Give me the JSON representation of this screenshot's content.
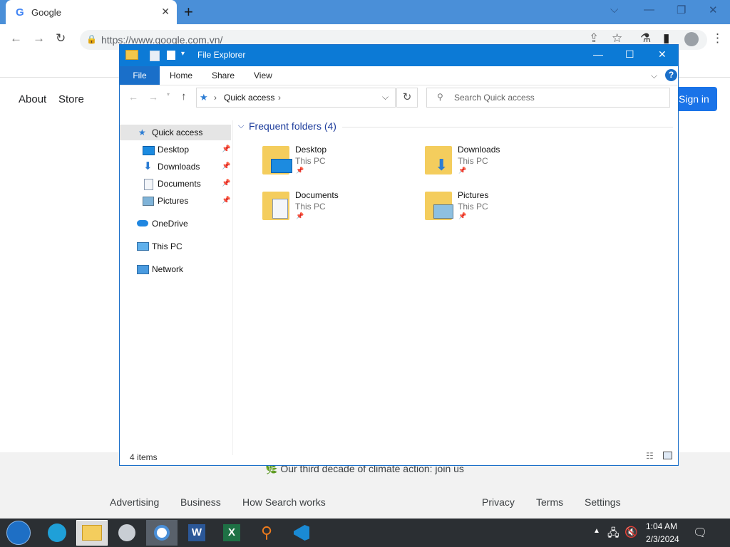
{
  "browser": {
    "tab_title": "Google",
    "tab_favicon": "G",
    "url": "https://www.google.com.vn/",
    "tab_close_glyph": "✕",
    "new_tab_glyph": "+"
  },
  "google_page": {
    "nav_left": [
      "About",
      "Store"
    ],
    "signin_label": "Sign in",
    "climate_text": "🌿 Our third decade of climate action: join us",
    "footer_links_left": [
      "Advertising",
      "Business",
      "How Search works"
    ],
    "footer_links_right": [
      "Privacy",
      "Terms",
      "Settings"
    ]
  },
  "explorer": {
    "title": "File Explorer",
    "ribbon_tabs": [
      "File",
      "Home",
      "Share",
      "View"
    ],
    "address_path": "Quick access",
    "search_placeholder": "Search Quick access",
    "nav": {
      "quick_access": "Quick access",
      "pinned": [
        "Desktop",
        "Downloads",
        "Documents",
        "Pictures"
      ],
      "onedrive": "OneDrive",
      "this_pc": "This PC",
      "network": "Network"
    },
    "section_header": "Frequent folders (4)",
    "folders": [
      {
        "name": "Desktop",
        "location": "This PC"
      },
      {
        "name": "Downloads",
        "location": "This PC"
      },
      {
        "name": "Documents",
        "location": "This PC"
      },
      {
        "name": "Pictures",
        "location": "This PC"
      }
    ],
    "status": "4 items"
  },
  "taskbar": {
    "apps": [
      "start-orb",
      "edge",
      "file-explorer",
      "app-unknown",
      "chrome",
      "word",
      "excel",
      "search-tool",
      "vscode"
    ],
    "clock_time": "1:04 AM",
    "clock_date": "2/3/2024"
  },
  "colors": {
    "explorer_accent": "#0c7ad6",
    "chrome_frame": "#4a8fd8",
    "taskbar": "#2b2f33"
  }
}
